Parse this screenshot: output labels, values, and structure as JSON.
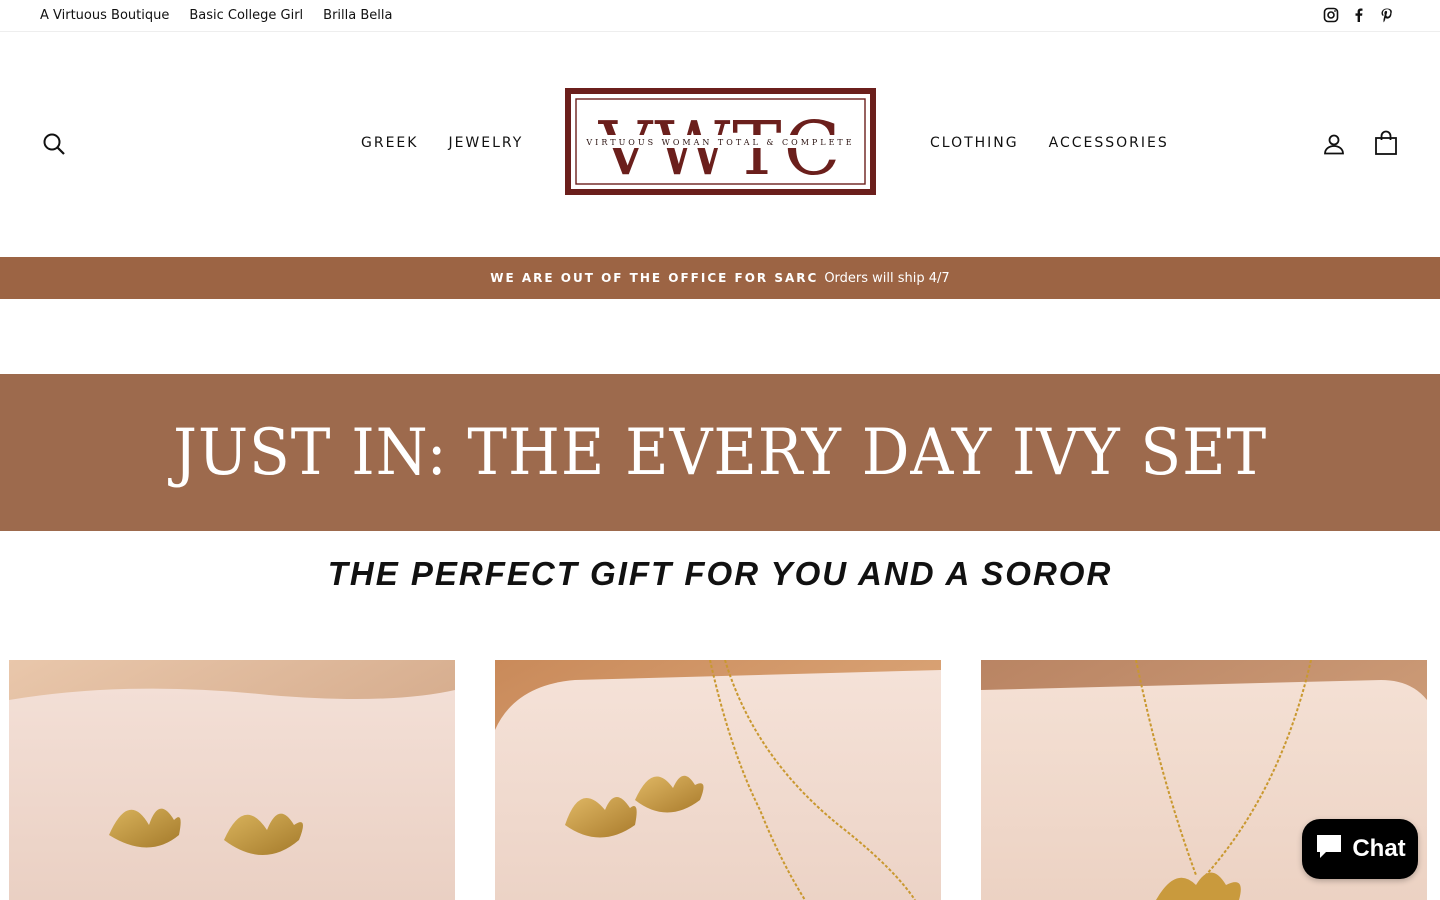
{
  "topbar": {
    "links": [
      "A Virtuous Boutique",
      "Basic College Girl",
      "Brilla Bella"
    ],
    "social_icons": [
      "instagram-icon",
      "facebook-icon",
      "pinterest-icon"
    ]
  },
  "nav": {
    "left": [
      "GREEK",
      "JEWELRY"
    ],
    "right": [
      "CLOTHING",
      "ACCESSORIES"
    ],
    "login_icon": "user-icon",
    "cart_icon": "bag-icon",
    "search_icon": "search-icon"
  },
  "logo": {
    "letters": "VWTC",
    "tagline": "VIRTUOUS WOMAN TOTAL & COMPLETE",
    "color": "#6b1f1c"
  },
  "announcement": {
    "bold": "WE ARE OUT OF THE OFFICE FOR SARC",
    "text": "Orders will ship 4/7",
    "background": "#9c6444"
  },
  "banner": {
    "title": "JUST IN: THE EVERY DAY IVY SET",
    "background": "#9d6a4d"
  },
  "subtitle": "THE PERFECT GIFT FOR YOU AND A SOROR",
  "chat": {
    "label": "Chat",
    "icon": "chat-bubble-icon"
  }
}
